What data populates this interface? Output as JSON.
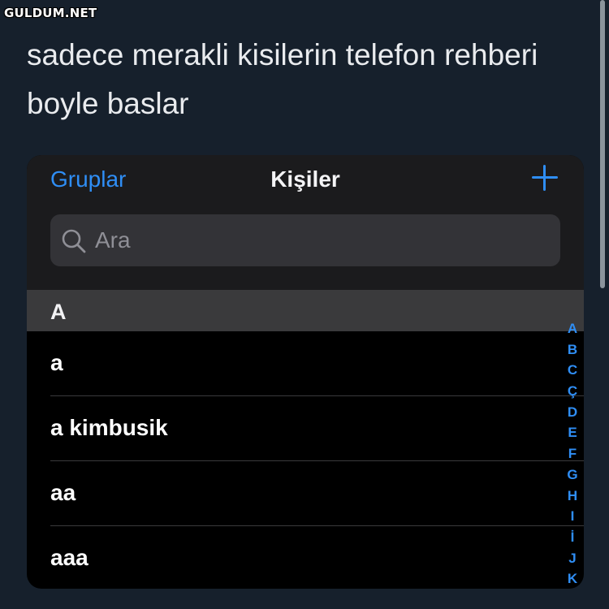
{
  "watermark": "GULDUM.NET",
  "tweet": {
    "text": "sadece merakli kisilerin telefon rehberi boyle baslar"
  },
  "contacts_app": {
    "nav": {
      "groups_label": "Gruplar",
      "title": "Kişiler",
      "add_icon": "plus-icon"
    },
    "search": {
      "placeholder": "Ara",
      "icon": "search-icon"
    },
    "section": "A",
    "contacts": [
      "a",
      "a kimbusik",
      "aa",
      "aaa"
    ],
    "index_letters": [
      "A",
      "B",
      "C",
      "Ç",
      "D",
      "E",
      "F",
      "G",
      "H",
      "I",
      "İ",
      "J",
      "K"
    ]
  },
  "colors": {
    "accent": "#2f8ef5",
    "background": "#16202c",
    "list_background": "#000000",
    "section_background": "#3a3a3c"
  }
}
